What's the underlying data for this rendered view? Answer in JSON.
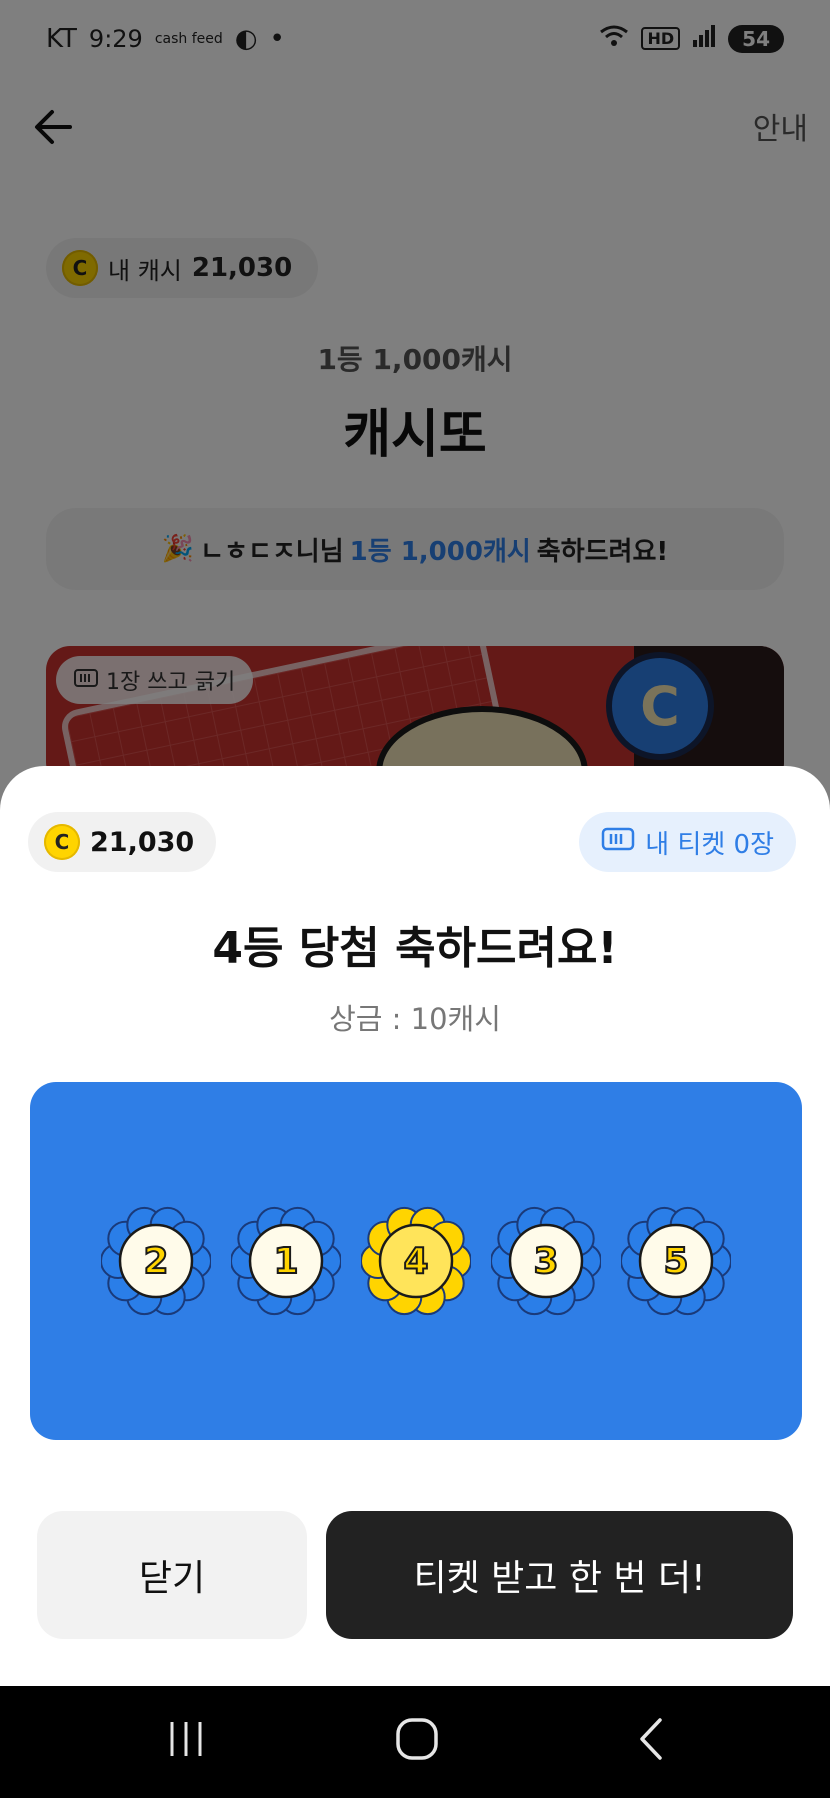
{
  "status_bar": {
    "carrier": "KT",
    "time": "9:29",
    "app_label": "cash feed",
    "battery": "54"
  },
  "header": {
    "guide_label": "안내"
  },
  "background_page": {
    "my_cash_label": "내 캐시",
    "my_cash_amount": "21,030",
    "coin_symbol": "C",
    "prize_subtitle": "1등 1,000캐시",
    "title": "캐시또",
    "winner_banner": {
      "emoji": "🎉",
      "name": "ㄴㅎㄷㅈ니님",
      "highlight": "1등 1,000캐시",
      "suffix": "축하드려요!"
    },
    "scratch_chip_label": "1장 쓰고 긁기"
  },
  "sheet": {
    "cash_amount": "21,030",
    "ticket_label": "내 티켓 0장",
    "result_title": "4등 당첨 축하드려요!",
    "prize_text": "상금 : 10캐시",
    "numbers": [
      {
        "value": "2",
        "matched": false
      },
      {
        "value": "1",
        "matched": false
      },
      {
        "value": "4",
        "matched": true
      },
      {
        "value": "3",
        "matched": false
      },
      {
        "value": "5",
        "matched": false
      }
    ],
    "close_label": "닫기",
    "retry_label": "티켓 받고 한 번 더!"
  },
  "colors": {
    "accent_blue": "#2f7ee6",
    "coin_yellow": "#ffd400",
    "dark_button": "#222222"
  },
  "icons": [
    "back-arrow-icon",
    "coin-icon",
    "ticket-icon",
    "recent-apps-icon",
    "home-icon",
    "back-nav-icon"
  ]
}
